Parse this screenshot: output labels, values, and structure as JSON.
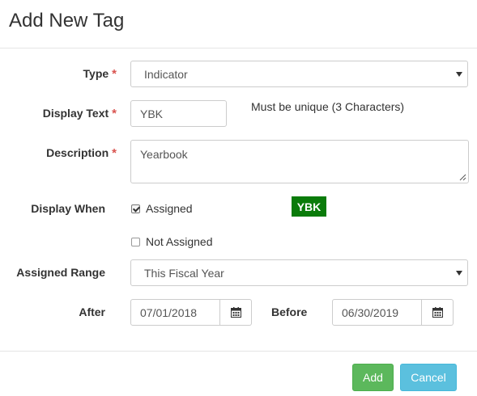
{
  "dialog": {
    "title": "Add New Tag"
  },
  "form": {
    "type": {
      "label": "Type",
      "value": "Indicator"
    },
    "display_text": {
      "label": "Display Text",
      "value": "YBK",
      "hint": "Must be unique (3 Characters)"
    },
    "description": {
      "label": "Description",
      "value": "Yearbook"
    },
    "display_when": {
      "label": "Display When",
      "assigned": {
        "label": "Assigned",
        "checked": true
      },
      "not_assigned": {
        "label": "Not Assigned",
        "checked": false
      },
      "preview_badge": "YBK",
      "badge_color": "#0a7b0a"
    },
    "assigned_range": {
      "label": "Assigned Range",
      "value": "This Fiscal Year"
    },
    "after": {
      "label": "After",
      "value": "07/01/2018"
    },
    "before": {
      "label": "Before",
      "value": "06/30/2019"
    },
    "required_marker": "*"
  },
  "footer": {
    "add_label": "Add",
    "cancel_label": "Cancel"
  },
  "colors": {
    "required": "#d9534f",
    "add": "#5cb85c",
    "cancel": "#5bc0de"
  },
  "icons": {
    "date_picker": "calendar-icon",
    "select": "caret-down-icon"
  }
}
